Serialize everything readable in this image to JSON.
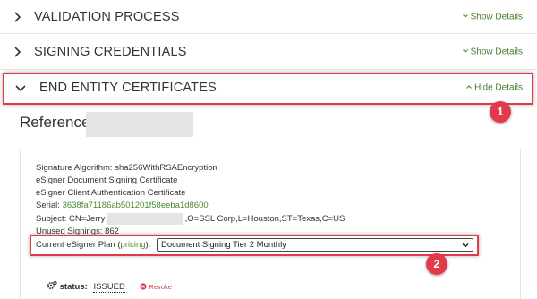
{
  "accordion": {
    "validation": {
      "title": "VALIDATION PROCESS",
      "toggle": "Show Details"
    },
    "credentials": {
      "title": "SIGNING CREDENTIALS",
      "toggle": "Show Details"
    },
    "end_entity": {
      "title": "END ENTITY CERTIFICATES",
      "toggle": "Hide Details"
    }
  },
  "reference": {
    "label": "Reference:"
  },
  "certificate": {
    "sig_alg_label": "Signature Algorithm:",
    "sig_alg_value": "sha256WithRSAEncryption",
    "doc_cert": "eSigner Document Signing Certificate",
    "client_cert": "eSigner Client Authentication Certificate",
    "serial_label": "Serial:",
    "serial_value": "3638fa71186ab501201f58eeba1d8600",
    "subject_label": "Subject: CN=Jerry",
    "subject_rest": ",O=SSL Corp,L=Houston,ST=Texas,C=US",
    "unused_signings": "Unused Signings: 862",
    "plan_label_pre": "Current eSigner Plan (",
    "plan_link": "pricing",
    "plan_label_post": "):",
    "plan_selected": "Document Signing Tier 2 Monthly"
  },
  "status": {
    "label": "status:",
    "value": "ISSUED",
    "revoke": "Revoke"
  },
  "annotations": {
    "badge1": "1",
    "badge2": "2"
  },
  "colors": {
    "accent_red": "#e23a4a",
    "link_green": "#4a8a2a",
    "toggle_green": "#4a7d2e"
  }
}
